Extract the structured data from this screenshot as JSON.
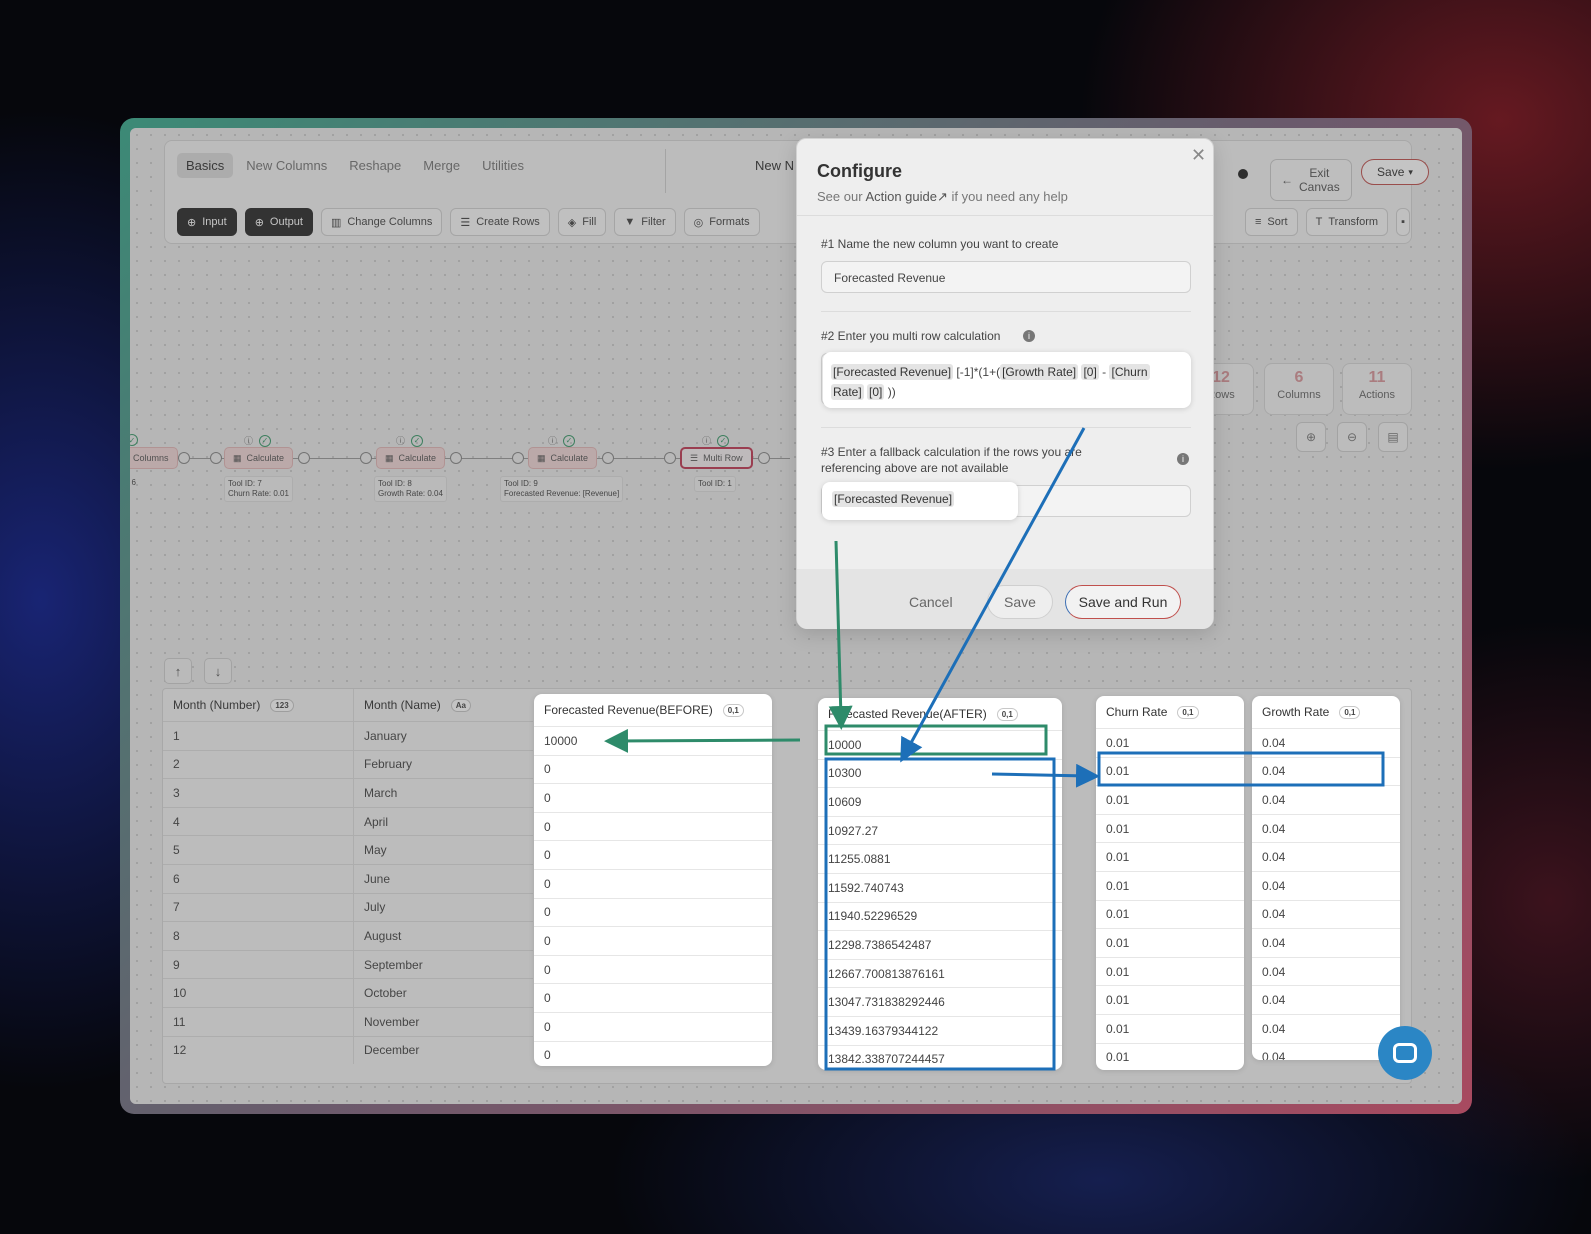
{
  "toolbar": {
    "tabs": [
      "Basics",
      "New Columns",
      "Reshape",
      "Merge",
      "Utilities"
    ],
    "new_label": "New N",
    "tools": [
      "Input",
      "Output",
      "Change Columns",
      "Create Rows",
      "Fill",
      "Filter",
      "Formats"
    ],
    "right_tools": [
      "Sort",
      "Transform"
    ],
    "exit_label_1": "Exit",
    "exit_label_2": "Canvas",
    "save_label": "Save"
  },
  "stats": [
    {
      "num": "12",
      "label": "Rows"
    },
    {
      "num": "6",
      "label": "Columns"
    },
    {
      "num": "11",
      "label": "Actions"
    }
  ],
  "flow": {
    "first_node_label": "Columns",
    "first_node_info": ": 6",
    "nodes": [
      {
        "label": "Calculate",
        "id": "Tool ID: 7",
        "detail": "Churn Rate: 0.01"
      },
      {
        "label": "Calculate",
        "id": "Tool ID: 8",
        "detail": "Growth Rate: 0.04"
      },
      {
        "label": "Calculate",
        "id": "Tool ID: 9",
        "detail": "Forecasted Revenue: [Revenue]"
      },
      {
        "label": "Multi Row",
        "id": "Tool ID: 1",
        "detail": ""
      }
    ]
  },
  "dialog": {
    "title": "Configure",
    "subtitle_prefix": "See our ",
    "subtitle_link": "Action guide↗",
    "subtitle_suffix": " if you need any help",
    "q1": "#1 Name the new column you want to create",
    "q1_value": "Forecasted Revenue",
    "q2": "#2 Enter you multi row calculation",
    "formula": {
      "c1": "[Forecasted Revenue]",
      "t1": " [-1]*(1+(",
      "c2": "[Growth Rate]",
      "c3": "[0]",
      "t2": " - ",
      "c4": "[Churn",
      "c5": "Rate]",
      "c6": "[0]",
      "t3": " ))"
    },
    "q3_line1": "#3 Enter a fallback calculation if the rows you are",
    "q3_line2": "referencing above are not available",
    "fallback": "[Forecasted Revenue]",
    "cancel": "Cancel",
    "save": "Save",
    "save_run": "Save and Run"
  },
  "table": {
    "columns": [
      {
        "name": "Month (Number)",
        "type": "123"
      },
      {
        "name": "Month (Name)",
        "type": "Aa"
      },
      {
        "name": "Forecasted Revenue(BEFORE)",
        "type": "0,1"
      },
      {
        "name": "Forecasted Revenue(AFTER)",
        "type": "0,1"
      },
      {
        "name": "Churn Rate",
        "type": "0,1"
      },
      {
        "name": "Growth Rate",
        "type": "0,1"
      }
    ],
    "rows": [
      [
        "1",
        "January",
        "10000",
        "10000",
        "0.01",
        "0.04"
      ],
      [
        "2",
        "February",
        "0",
        "10300",
        "0.01",
        "0.04"
      ],
      [
        "3",
        "March",
        "0",
        "10609",
        "0.01",
        "0.04"
      ],
      [
        "4",
        "April",
        "0",
        "10927.27",
        "0.01",
        "0.04"
      ],
      [
        "5",
        "May",
        "0",
        "11255.0881",
        "0.01",
        "0.04"
      ],
      [
        "6",
        "June",
        "0",
        "11592.740743",
        "0.01",
        "0.04"
      ],
      [
        "7",
        "July",
        "0",
        "11940.52296529",
        "0.01",
        "0.04"
      ],
      [
        "8",
        "August",
        "0",
        "12298.7386542487",
        "0.01",
        "0.04"
      ],
      [
        "9",
        "September",
        "0",
        "12667.700813876161",
        "0.01",
        "0.04"
      ],
      [
        "10",
        "October",
        "0",
        "13047.731838292446",
        "0.01",
        "0.04"
      ],
      [
        "11",
        "November",
        "0",
        "13439.16379344122",
        "0.01",
        "0.04"
      ],
      [
        "12",
        "December",
        "0",
        "13842.338707244457",
        "0.01",
        "0.04"
      ]
    ]
  },
  "colors": {
    "green_arrow": "#2e8b6a",
    "blue_arrow": "#1d6fb8",
    "accent_red": "#c0504d"
  }
}
